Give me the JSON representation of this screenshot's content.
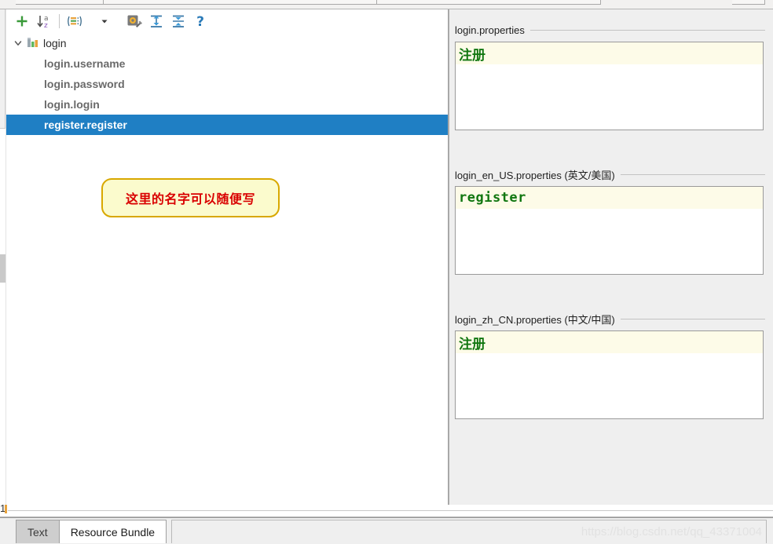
{
  "colors": {
    "selection_blue": "#1f7fc4",
    "callout_fill": "#fbfbcd",
    "callout_border": "#d8a800",
    "callout_text": "#d90000",
    "value_green": "#117711",
    "caret_line": "#fdfbe8",
    "panel_bg": "#efefef"
  },
  "toolbar": {
    "buttons": [
      {
        "name": "add-property-button",
        "icon": "plus-icon",
        "title": "Add Property"
      },
      {
        "name": "sort-alphabetically-button",
        "icon": "sort-az-icon",
        "title": "Sort Alphabetically"
      },
      {
        "name": "group-by-prefix-button",
        "icon": "group-list-icon",
        "title": "Group by Prefix"
      },
      {
        "name": "toolbar-dropdown-button",
        "icon": "chevron-down-icon",
        "title": "More Options"
      },
      {
        "name": "settings-button",
        "icon": "gear-wrench-icon",
        "title": "Settings"
      },
      {
        "name": "expand-all-button",
        "icon": "expand-all-icon",
        "title": "Expand All"
      },
      {
        "name": "collapse-all-button",
        "icon": "collapse-all-icon",
        "title": "Collapse All"
      },
      {
        "name": "help-button",
        "icon": "question-mark-icon",
        "title": "Help"
      }
    ]
  },
  "tree": {
    "root": {
      "label": "login",
      "icon": "resource-bundle-icon",
      "expanded": true,
      "chevron": "chevron-down-icon"
    },
    "items": [
      {
        "label": "login.username",
        "selected": false
      },
      {
        "label": "login.password",
        "selected": false
      },
      {
        "label": "login.login",
        "selected": false
      },
      {
        "label": "register.register",
        "selected": true
      }
    ]
  },
  "callout": {
    "text": "这里的名字可以随便写"
  },
  "locales": [
    {
      "title": "login.properties",
      "value": "注册",
      "script": "cjk"
    },
    {
      "title": "login_en_US.properties (英文/美国)",
      "value": "register",
      "script": "mono"
    },
    {
      "title": "login_zh_CN.properties (中文/中国)",
      "value": "注册",
      "script": "cjk"
    }
  ],
  "editor_gutter": {
    "line_number": "1"
  },
  "tabs": [
    {
      "label": "Text",
      "active": false
    },
    {
      "label": "Resource Bundle",
      "active": true
    }
  ],
  "watermark": {
    "text": "https://blog.csdn.net/qq_43371004"
  }
}
